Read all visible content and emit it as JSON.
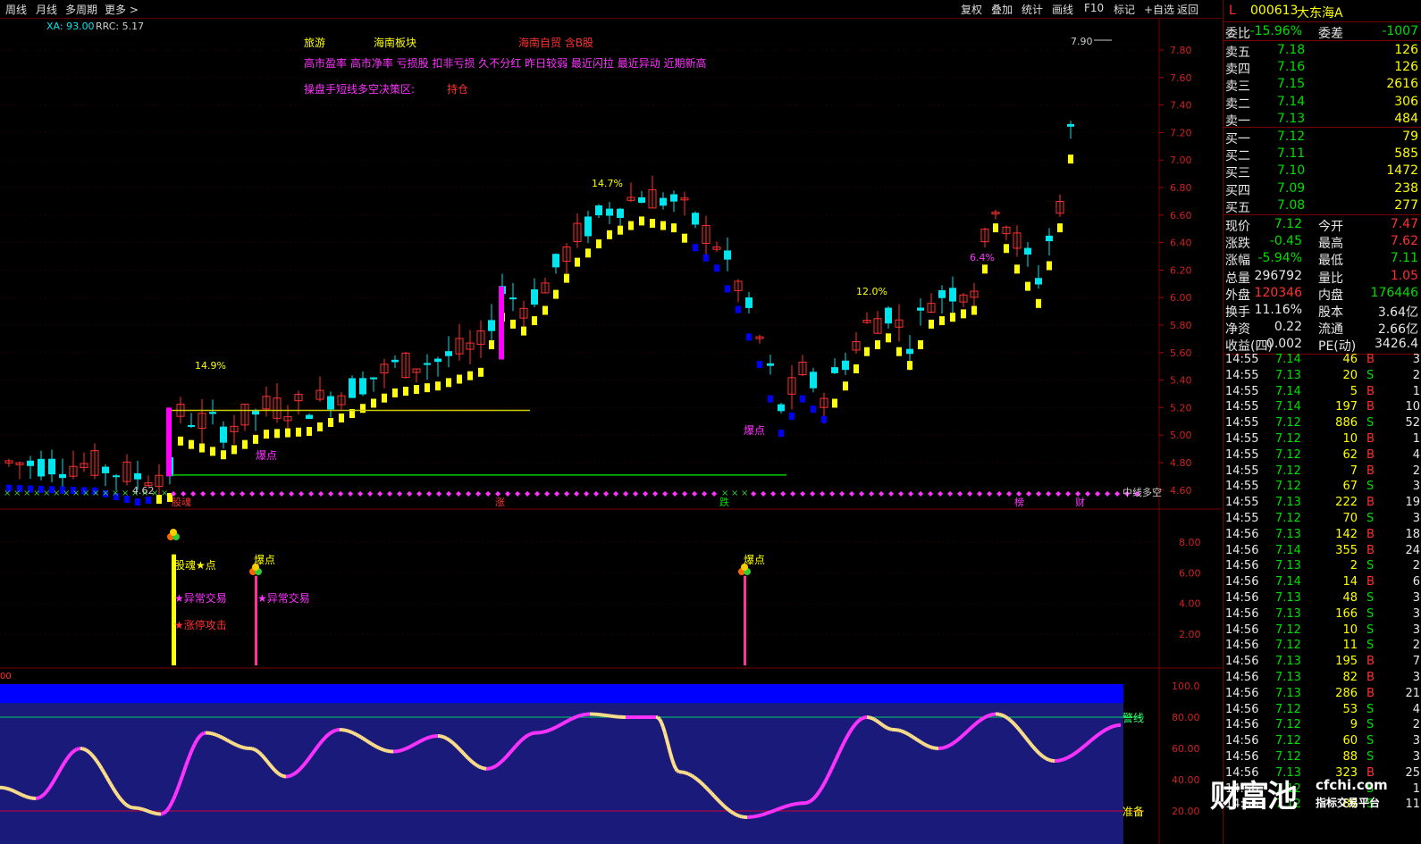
{
  "toolbar": {
    "left": [
      "周线",
      "月线",
      "多周期",
      "更多 >"
    ],
    "right": [
      "复权",
      "叠加",
      "统计",
      "画线",
      "F10",
      "标记",
      "+自选",
      "返回"
    ]
  },
  "indicator_header": {
    "xa": "XA: 93.00",
    "rrc": "RRC: 5.17"
  },
  "annotations": {
    "sector1": "旅游",
    "sector2": "海南板块",
    "sector3": "海南自贸 含B股",
    "tags": "高市盈率 高市净率 亏损股 扣非亏损 久不分红 昨日较弱 最近闪拉 最近异动 近期新高",
    "strategy": "操盘手短线多空决策区:",
    "strategy_value": "持仓",
    "pct1": "14.9%",
    "pct2": "14.7%",
    "pct3": "12.0%",
    "pct4": "6.4%",
    "high_label": "7.90",
    "low_label": "4.62",
    "burst1": "爆点",
    "burst2": "爆点",
    "mid_line": "中线多空",
    "bottom_marks": [
      "股魂",
      "涨",
      "跌",
      "榜",
      "财"
    ],
    "sub_burst1": "爆点",
    "sub_burst2": "爆点",
    "sub_soul": "股魂★点",
    "sub_abnormal1": "★异常交易",
    "sub_abnormal2": "★异常交易",
    "sub_limit": "★涨停攻击",
    "warn_line": "警线",
    "ready_line": "准备",
    "osc_prefix": "00"
  },
  "price_axis": [
    "7.80",
    "7.60",
    "7.40",
    "7.20",
    "7.00",
    "6.80",
    "6.60",
    "6.40",
    "6.20",
    "6.00",
    "5.80",
    "5.60",
    "5.40",
    "5.20",
    "5.00",
    "4.80",
    "4.60"
  ],
  "sub_axis": [
    "8.00",
    "6.00",
    "4.00",
    "2.00"
  ],
  "osc_axis": [
    "100.0",
    "80.00",
    "60.00",
    "40.00",
    "20.00"
  ],
  "stock": {
    "mark": "L",
    "code": "000613",
    "name": "大东海A"
  },
  "quote": {
    "weibi": {
      "label": "委比",
      "value": "-15.96%",
      "label2": "委差",
      "value2": "-1007"
    },
    "sells": [
      {
        "label": "卖五",
        "price": "7.18",
        "vol": "126"
      },
      {
        "label": "卖四",
        "price": "7.16",
        "vol": "126"
      },
      {
        "label": "卖三",
        "price": "7.15",
        "vol": "2616"
      },
      {
        "label": "卖二",
        "price": "7.14",
        "vol": "306"
      },
      {
        "label": "卖一",
        "price": "7.13",
        "vol": "484"
      }
    ],
    "buys": [
      {
        "label": "买一",
        "price": "7.12",
        "vol": "79"
      },
      {
        "label": "买二",
        "price": "7.11",
        "vol": "585"
      },
      {
        "label": "买三",
        "price": "7.10",
        "vol": "1472"
      },
      {
        "label": "买四",
        "price": "7.09",
        "vol": "238"
      },
      {
        "label": "买五",
        "price": "7.08",
        "vol": "277"
      }
    ],
    "stats": [
      {
        "l1": "现价",
        "v1": "7.12",
        "c1": "g",
        "l2": "今开",
        "v2": "7.47",
        "c2": "r"
      },
      {
        "l1": "涨跌",
        "v1": "-0.45",
        "c1": "g",
        "l2": "最高",
        "v2": "7.62",
        "c2": "r"
      },
      {
        "l1": "涨幅",
        "v1": "-5.94%",
        "c1": "g",
        "l2": "最低",
        "v2": "7.11",
        "c2": "g"
      },
      {
        "l1": "总量",
        "v1": "296792",
        "c1": "w",
        "l2": "量比",
        "v2": "1.05",
        "c2": "r"
      },
      {
        "l1": "外盘",
        "v1": "120346",
        "c1": "r",
        "l2": "内盘",
        "v2": "176446",
        "c2": "g"
      },
      {
        "l1": "换手",
        "v1": "11.16%",
        "c1": "w",
        "l2": "股本",
        "v2": "3.64亿",
        "c2": "w"
      },
      {
        "l1": "净资",
        "v1": "0.22",
        "c1": "w",
        "l2": "流通",
        "v2": "2.66亿",
        "c2": "w"
      },
      {
        "l1": "收益(四)",
        "v1": "0.002",
        "c1": "w",
        "l2": "PE(动)",
        "v2": "3426.4",
        "c2": "w"
      }
    ]
  },
  "ticks": [
    {
      "t": "14:55",
      "p": "7.14",
      "v": "46",
      "s": "B",
      "n": "3"
    },
    {
      "t": "14:55",
      "p": "7.13",
      "v": "20",
      "s": "S",
      "n": "2"
    },
    {
      "t": "14:55",
      "p": "7.14",
      "v": "5",
      "s": "B",
      "n": "1"
    },
    {
      "t": "14:55",
      "p": "7.14",
      "v": "197",
      "s": "B",
      "n": "10"
    },
    {
      "t": "14:55",
      "p": "7.12",
      "v": "886",
      "s": "S",
      "n": "52"
    },
    {
      "t": "14:55",
      "p": "7.12",
      "v": "10",
      "s": "B",
      "n": "1"
    },
    {
      "t": "14:55",
      "p": "7.12",
      "v": "62",
      "s": "B",
      "n": "4"
    },
    {
      "t": "14:55",
      "p": "7.12",
      "v": "7",
      "s": "B",
      "n": "2"
    },
    {
      "t": "14:55",
      "p": "7.12",
      "v": "67",
      "s": "S",
      "n": "3"
    },
    {
      "t": "14:55",
      "p": "7.13",
      "v": "222",
      "s": "B",
      "n": "19"
    },
    {
      "t": "14:55",
      "p": "7.12",
      "v": "70",
      "s": "S",
      "n": "3"
    },
    {
      "t": "14:56",
      "p": "7.13",
      "v": "142",
      "s": "B",
      "n": "18"
    },
    {
      "t": "14:56",
      "p": "7.14",
      "v": "355",
      "s": "B",
      "n": "24"
    },
    {
      "t": "14:56",
      "p": "7.13",
      "v": "2",
      "s": "S",
      "n": "2"
    },
    {
      "t": "14:56",
      "p": "7.14",
      "v": "14",
      "s": "B",
      "n": "6"
    },
    {
      "t": "14:56",
      "p": "7.13",
      "v": "48",
      "s": "S",
      "n": "3"
    },
    {
      "t": "14:56",
      "p": "7.13",
      "v": "166",
      "s": "S",
      "n": "3"
    },
    {
      "t": "14:56",
      "p": "7.12",
      "v": "10",
      "s": "S",
      "n": "3"
    },
    {
      "t": "14:56",
      "p": "7.12",
      "v": "11",
      "s": "S",
      "n": "2"
    },
    {
      "t": "14:56",
      "p": "7.13",
      "v": "195",
      "s": "B",
      "n": "7"
    },
    {
      "t": "14:56",
      "p": "7.13",
      "v": "82",
      "s": "B",
      "n": "3"
    },
    {
      "t": "14:56",
      "p": "7.13",
      "v": "286",
      "s": "B",
      "n": "21"
    },
    {
      "t": "14:56",
      "p": "7.12",
      "v": "53",
      "s": "S",
      "n": "4"
    },
    {
      "t": "14:56",
      "p": "7.12",
      "v": "9",
      "s": "S",
      "n": "2"
    },
    {
      "t": "14:56",
      "p": "7.12",
      "v": "60",
      "s": "S",
      "n": "3"
    },
    {
      "t": "14:56",
      "p": "7.12",
      "v": "88",
      "s": "S",
      "n": "3"
    },
    {
      "t": "14:56",
      "p": "7.13",
      "v": "323",
      "s": "B",
      "n": "25"
    },
    {
      "t": "14:56",
      "p": "7.12",
      "v": "",
      "s": "S",
      "n": "1"
    },
    {
      "t": "14:56",
      "p": "7.12",
      "v": "86",
      "s": "S",
      "n": "11"
    }
  ],
  "watermark": {
    "logo": "财富池",
    "url": "cfchi.com",
    "slogan": "指标交易平台"
  },
  "colors": {
    "up": "#ff3030",
    "down": "#00dd00",
    "bull": "#ffff00",
    "bear": "#0000ff",
    "cyan": "#00e5ee",
    "magenta": "#ff00ff",
    "oscBg": "#1a1a7a",
    "oscTop": "#0000ff"
  }
}
